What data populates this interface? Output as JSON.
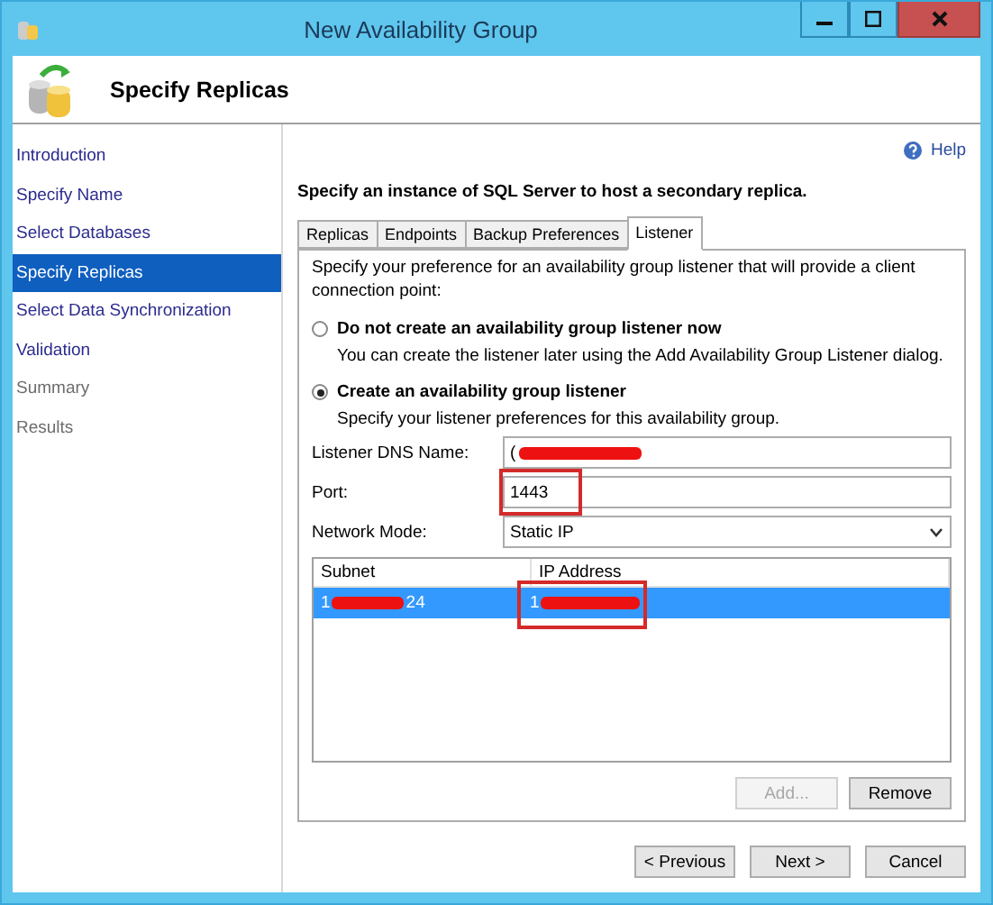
{
  "window": {
    "title": "New Availability Group"
  },
  "header": {
    "title": "Specify Replicas"
  },
  "sidebar": {
    "items": [
      {
        "label": "Introduction",
        "selected": false,
        "disabled": false
      },
      {
        "label": "Specify Name",
        "selected": false,
        "disabled": false
      },
      {
        "label": "Select Databases",
        "selected": false,
        "disabled": false
      },
      {
        "label": "Specify Replicas",
        "selected": true,
        "disabled": false
      },
      {
        "label": "Select Data Synchronization",
        "selected": false,
        "disabled": false
      },
      {
        "label": "Validation",
        "selected": false,
        "disabled": false
      },
      {
        "label": "Summary",
        "selected": false,
        "disabled": true
      },
      {
        "label": "Results",
        "selected": false,
        "disabled": true
      }
    ]
  },
  "help": {
    "label": "Help"
  },
  "instruction": "Specify an instance of SQL Server to host a secondary replica.",
  "tabs": [
    {
      "label": "Replicas",
      "selected": false
    },
    {
      "label": "Endpoints",
      "selected": false
    },
    {
      "label": "Backup Preferences",
      "selected": false
    },
    {
      "label": "Listener",
      "selected": true
    }
  ],
  "listener": {
    "intro": "Specify your preference for an availability group listener that will provide a client connection point:",
    "options": [
      {
        "label": "Do not create an availability group listener now",
        "description": "You can create the listener later using the Add Availability Group Listener dialog.",
        "selected": false
      },
      {
        "label": "Create an availability group listener",
        "description": "Specify your listener preferences for this availability group.",
        "selected": true
      }
    ],
    "fields": [
      {
        "kind": "text",
        "label": "Listener DNS Name:",
        "value": "(",
        "redacted": true,
        "highlighted": false
      },
      {
        "kind": "text",
        "label": "Port:",
        "value": "1443",
        "redacted": false,
        "highlighted": true
      },
      {
        "kind": "dropdown",
        "label": "Network Mode:",
        "value": "Static IP",
        "redacted": false,
        "highlighted": false
      }
    ],
    "table": {
      "columns": [
        "Subnet",
        "IP Address"
      ],
      "rows": [
        {
          "selected": true,
          "cells": [
            {
              "start": "1",
              "end": "24",
              "redacted": true,
              "highlighted": false
            },
            {
              "start": "1",
              "redacted": true,
              "highlighted": true
            }
          ]
        }
      ]
    },
    "buttons": [
      {
        "label": "Add...",
        "disabled": true
      },
      {
        "label": "Remove",
        "disabled": false
      }
    ]
  },
  "footer": {
    "buttons": [
      {
        "label": "< Previous",
        "disabled": false
      },
      {
        "label": "Next >",
        "disabled": false
      },
      {
        "label": "Cancel",
        "disabled": false
      }
    ]
  }
}
